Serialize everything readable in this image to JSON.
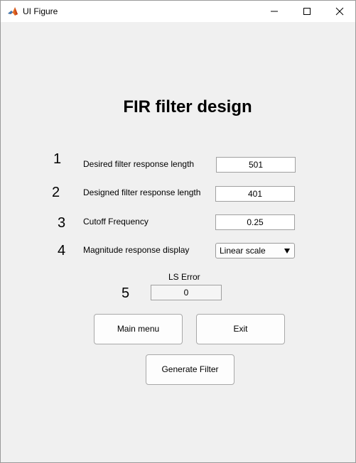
{
  "window": {
    "title": "UI Figure"
  },
  "heading": "FIR filter design",
  "rows": [
    {
      "number": "1",
      "label": "Desired filter response length",
      "value": "501"
    },
    {
      "number": "2",
      "label": "Designed filter response length",
      "value": "401"
    },
    {
      "number": "3",
      "label": "Cutoff Frequency",
      "value": "0.25"
    },
    {
      "number": "4",
      "label": "Magnitude response display",
      "value": "Linear scale"
    }
  ],
  "ls_error": {
    "number": "5",
    "label": "LS Error",
    "value": "0"
  },
  "buttons": {
    "main_menu": "Main menu",
    "exit": "Exit",
    "generate": "Generate Filter"
  },
  "icons": {
    "app": "matlab-logo-icon",
    "minimize": "minimize-icon",
    "maximize": "maximize-icon",
    "close": "close-icon"
  }
}
